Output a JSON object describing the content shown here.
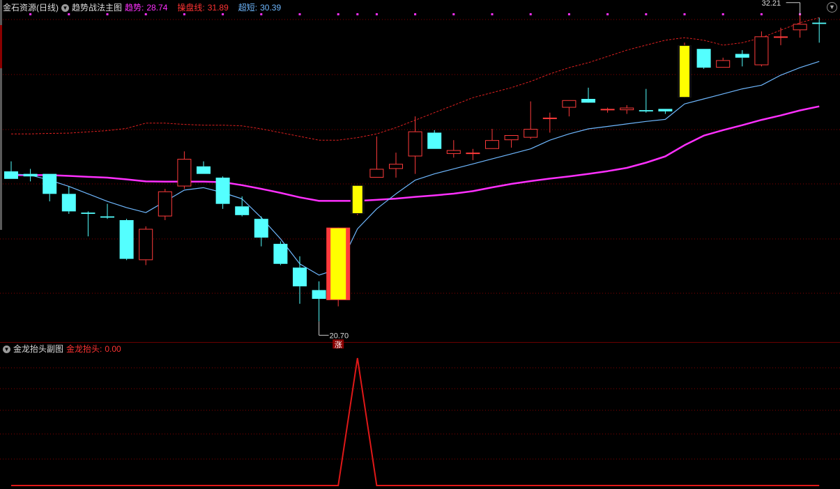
{
  "header": {
    "stock_name": "金石资源(日线)",
    "indicator_name": "趋势战法主图",
    "trend_label": "趋势:",
    "trend_value": "28.74",
    "cpx_label": "操盘线:",
    "cpx_value": "31.89",
    "short_label": "超短:",
    "short_value": "30.39"
  },
  "sub_header": {
    "indicator_name": "金龙抬头副图",
    "jl_label": "金龙抬头:",
    "jl_value": "0.00"
  },
  "annotations": {
    "high_label": "32.21",
    "low_label": "20.70",
    "signal_label": "涨"
  },
  "colors": {
    "up": "#ff3b3b",
    "down": "#54ffff",
    "signal_body": "#ffff00",
    "trend_line": "#ff30ff",
    "short_line": "#6fb8ff",
    "cpx_line": "#e02020",
    "jl_line": "#e01818",
    "grid": "#8b0000",
    "background": "#000000"
  },
  "chart_data": [
    {
      "type": "candlestick",
      "title": "趋势战法主图",
      "ylim": [
        19.9,
        33.0
      ],
      "grid": true,
      "candles": [
        {
          "o": 26.7,
          "h": 27.1,
          "l": 26.4,
          "c": 26.4
        },
        {
          "o": 26.6,
          "h": 26.8,
          "l": 26.3,
          "c": 26.5
        },
        {
          "o": 26.6,
          "h": 26.6,
          "l": 25.5,
          "c": 25.8
        },
        {
          "o": 25.8,
          "h": 26.1,
          "l": 25.0,
          "c": 25.1
        },
        {
          "o": 25.05,
          "h": 25.1,
          "l": 24.1,
          "c": 25.0
        },
        {
          "o": 24.9,
          "h": 25.4,
          "l": 24.8,
          "c": 24.85
        },
        {
          "o": 24.75,
          "h": 24.8,
          "l": 23.15,
          "c": 23.2
        },
        {
          "o": 23.15,
          "h": 24.5,
          "l": 22.95,
          "c": 24.4
        },
        {
          "o": 24.9,
          "h": 26.0,
          "l": 24.75,
          "c": 25.9
        },
        {
          "o": 26.1,
          "h": 27.5,
          "l": 26.0,
          "c": 27.2
        },
        {
          "o": 26.9,
          "h": 27.1,
          "l": 26.6,
          "c": 26.6
        },
        {
          "o": 26.45,
          "h": 26.5,
          "l": 25.2,
          "c": 25.4
        },
        {
          "o": 25.3,
          "h": 25.7,
          "l": 24.9,
          "c": 24.95
        },
        {
          "o": 24.8,
          "h": 24.9,
          "l": 23.7,
          "c": 24.05
        },
        {
          "o": 23.8,
          "h": 23.9,
          "l": 22.95,
          "c": 23.0
        },
        {
          "o": 22.85,
          "h": 23.3,
          "l": 21.4,
          "c": 22.1
        },
        {
          "o": 21.95,
          "h": 22.3,
          "l": 20.7,
          "c": 21.6
        },
        {
          "o": 21.55,
          "h": 24.45,
          "l": 21.3,
          "c": 24.45,
          "signal": true
        },
        {
          "o": 25.0,
          "h": 26.15,
          "l": 24.95,
          "c": 26.15,
          "signal": true
        },
        {
          "o": 26.45,
          "h": 28.1,
          "l": 26.45,
          "c": 26.8
        },
        {
          "o": 26.8,
          "h": 27.45,
          "l": 26.45,
          "c": 27.0
        },
        {
          "o": 27.3,
          "h": 28.9,
          "l": 26.6,
          "c": 28.3
        },
        {
          "o": 28.25,
          "h": 28.35,
          "l": 27.6,
          "c": 27.6
        },
        {
          "o": 27.4,
          "h": 27.95,
          "l": 27.25,
          "c": 27.55
        },
        {
          "o": 27.45,
          "h": 27.6,
          "l": 27.15,
          "c": 27.45
        },
        {
          "o": 27.6,
          "h": 28.4,
          "l": 27.6,
          "c": 27.95
        },
        {
          "o": 27.95,
          "h": 28.15,
          "l": 27.65,
          "c": 28.15
        },
        {
          "o": 28.05,
          "h": 29.5,
          "l": 28.0,
          "c": 28.4
        },
        {
          "o": 28.8,
          "h": 29.05,
          "l": 28.25,
          "c": 28.85
        },
        {
          "o": 29.25,
          "h": 29.55,
          "l": 28.9,
          "c": 29.55
        },
        {
          "o": 29.6,
          "h": 30.05,
          "l": 29.55,
          "c": 29.45
        },
        {
          "o": 29.2,
          "h": 29.25,
          "l": 29.05,
          "c": 29.2
        },
        {
          "o": 29.15,
          "h": 29.35,
          "l": 29.0,
          "c": 29.25
        },
        {
          "o": 29.15,
          "h": 30.0,
          "l": 29.05,
          "c": 29.1
        },
        {
          "o": 29.2,
          "h": 29.2,
          "l": 29.0,
          "c": 29.1
        },
        {
          "o": 29.65,
          "h": 31.85,
          "l": 29.65,
          "c": 31.75,
          "signal": true
        },
        {
          "o": 31.6,
          "h": 31.6,
          "l": 30.8,
          "c": 30.85
        },
        {
          "o": 30.85,
          "h": 31.25,
          "l": 30.85,
          "c": 31.15
        },
        {
          "o": 31.4,
          "h": 31.55,
          "l": 30.9,
          "c": 31.25
        },
        {
          "o": 30.95,
          "h": 32.3,
          "l": 30.9,
          "c": 32.1
        },
        {
          "o": 32.1,
          "h": 32.45,
          "l": 31.75,
          "c": 32.1
        },
        {
          "o": 32.35,
          "h": 32.95,
          "l": 32.05,
          "c": 32.6
        },
        {
          "o": 32.65,
          "h": 32.85,
          "l": 31.85,
          "c": 32.6
        }
      ],
      "series": [
        {
          "name": "趋势",
          "values": [
            26.55,
            26.55,
            26.55,
            26.52,
            26.48,
            26.45,
            26.38,
            26.3,
            26.29,
            26.29,
            26.29,
            26.27,
            26.15,
            26.0,
            25.84,
            25.66,
            25.52,
            25.52,
            25.52,
            25.56,
            25.61,
            25.68,
            25.74,
            25.81,
            25.91,
            26.06,
            26.2,
            26.31,
            26.41,
            26.5,
            26.6,
            26.71,
            26.84,
            27.05,
            27.3,
            27.75,
            28.13,
            28.35,
            28.55,
            28.76,
            28.94,
            29.14,
            29.3
          ]
        },
        {
          "name": "操盘线",
          "values": [
            28.2,
            28.2,
            28.22,
            28.23,
            28.28,
            28.33,
            28.42,
            28.63,
            28.63,
            28.58,
            28.55,
            28.55,
            28.52,
            28.4,
            28.25,
            28.1,
            27.95,
            27.95,
            28.05,
            28.2,
            28.45,
            28.75,
            29.05,
            29.35,
            29.65,
            29.85,
            30.05,
            30.3,
            30.6,
            30.85,
            31.05,
            31.3,
            31.55,
            31.75,
            31.95,
            32.05,
            31.95,
            31.75,
            31.85,
            32.05,
            32.35,
            32.65,
            32.85
          ]
        },
        {
          "name": "超短",
          "values": [
            26.6,
            26.55,
            26.35,
            26.1,
            25.8,
            25.5,
            25.25,
            25.05,
            25.5,
            25.95,
            26.05,
            25.85,
            25.6,
            24.85,
            24.0,
            23.0,
            22.55,
            22.8,
            24.4,
            25.2,
            25.8,
            26.35,
            26.6,
            26.8,
            27.0,
            27.2,
            27.4,
            27.6,
            27.95,
            28.2,
            28.4,
            28.5,
            28.6,
            28.7,
            28.78,
            29.4,
            29.6,
            29.8,
            30.0,
            30.15,
            30.55,
            30.85,
            31.1
          ]
        }
      ]
    },
    {
      "type": "line",
      "title": "金龙抬头副图",
      "ylim": [
        0,
        1
      ],
      "series": [
        {
          "name": "金龙抬头",
          "values": [
            0,
            0,
            0,
            0,
            0,
            0,
            0,
            0,
            0,
            0,
            0,
            0,
            0,
            0,
            0,
            0,
            0,
            0,
            1,
            0,
            0,
            0,
            0,
            0,
            0,
            0,
            0,
            0,
            0,
            0,
            0,
            0,
            0,
            0,
            0,
            0,
            0,
            0,
            0,
            0,
            0,
            0,
            0
          ]
        }
      ]
    }
  ]
}
